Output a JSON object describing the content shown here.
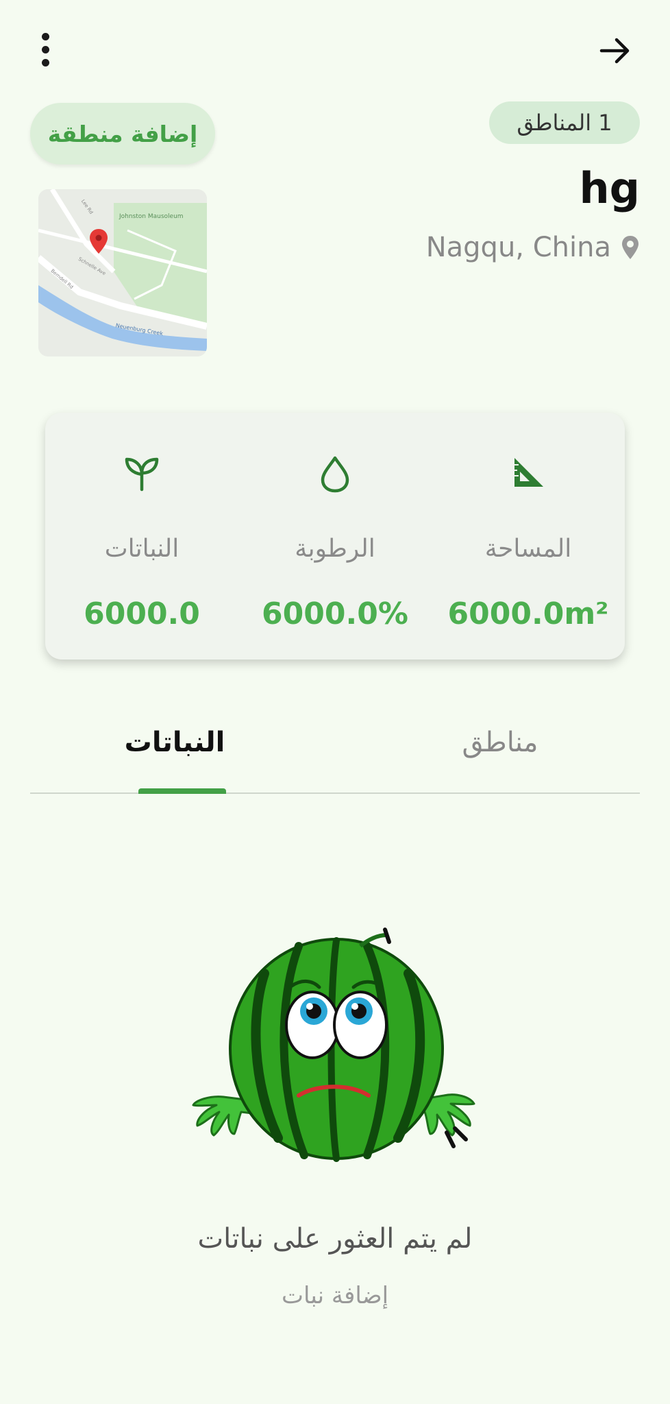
{
  "header": {
    "regions_badge": "1 المناطق",
    "add_zone_label": "إضافة منطقة",
    "title": "hg",
    "location": "Nagqu, China"
  },
  "map": {
    "labels": [
      "Johnston Mausoleum",
      "Neuenburg Creek",
      "Schnelle Ave",
      "Bemdell Rd",
      "Lee Rd"
    ]
  },
  "stats": {
    "area": {
      "label": "المساحة",
      "value": "6000.0m²",
      "icon": "set-square-icon"
    },
    "humidity": {
      "label": "الرطوبة",
      "value": "6000.0%",
      "icon": "water-drop-icon"
    },
    "plants": {
      "label": "النباتات",
      "value": "6000.0",
      "icon": "sprout-icon"
    }
  },
  "tabs": {
    "plants": "النباتات",
    "zones": "مناطق",
    "active": "plants"
  },
  "empty_state": {
    "title": "لم يتم العثور على نباتات",
    "action": "إضافة نبات"
  },
  "colors": {
    "accent": "#43a047",
    "value_green": "#4caf50",
    "background": "#f5fbf1",
    "badge_bg": "#d6ecd6"
  }
}
